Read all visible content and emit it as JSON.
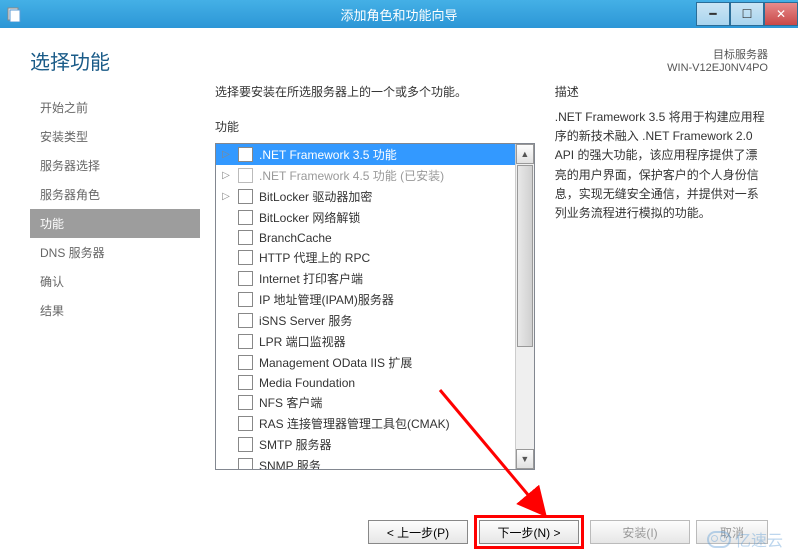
{
  "window": {
    "title": "添加角色和功能向导"
  },
  "header": {
    "title": "选择功能",
    "target_label": "目标服务器",
    "target_value": "WIN-V12EJ0NV4PO"
  },
  "intro": "选择要安装在所选服务器上的一个或多个功能。",
  "nav": {
    "items": [
      {
        "label": "开始之前"
      },
      {
        "label": "安装类型"
      },
      {
        "label": "服务器选择"
      },
      {
        "label": "服务器角色"
      },
      {
        "label": "功能",
        "active": true
      },
      {
        "label": "DNS 服务器"
      },
      {
        "label": "确认"
      },
      {
        "label": "结果"
      }
    ]
  },
  "features": {
    "heading": "功能",
    "items": [
      {
        "label": ".NET Framework 3.5 功能",
        "selected": true,
        "expandable": true
      },
      {
        "label": ".NET Framework 4.5 功能 (已安装)",
        "disabled": true,
        "expandable": true
      },
      {
        "label": "BitLocker 驱动器加密",
        "expandable": true
      },
      {
        "label": "BitLocker 网络解锁"
      },
      {
        "label": "BranchCache"
      },
      {
        "label": "HTTP 代理上的 RPC"
      },
      {
        "label": "Internet 打印客户端"
      },
      {
        "label": "IP 地址管理(IPAM)服务器"
      },
      {
        "label": "iSNS Server 服务"
      },
      {
        "label": "LPR 端口监视器"
      },
      {
        "label": "Management OData IIS 扩展"
      },
      {
        "label": "Media Foundation"
      },
      {
        "label": "NFS 客户端"
      },
      {
        "label": "RAS 连接管理器管理工具包(CMAK)"
      },
      {
        "label": "SMTP 服务器"
      },
      {
        "label": "SNMP 服务"
      }
    ]
  },
  "description": {
    "heading": "描述",
    "text": ".NET Framework 3.5 将用于构建应用程序的新技术融入 .NET Framework 2.0 API 的强大功能，该应用程序提供了漂亮的用户界面，保护客户的个人身份信息，实现无缝安全通信，并提供对一系列业务流程进行模拟的功能。"
  },
  "footer": {
    "prev": "< 上一步(P)",
    "next": "下一步(N) >",
    "install": "安装(I)",
    "cancel": "取消"
  },
  "watermark": "亿速云"
}
